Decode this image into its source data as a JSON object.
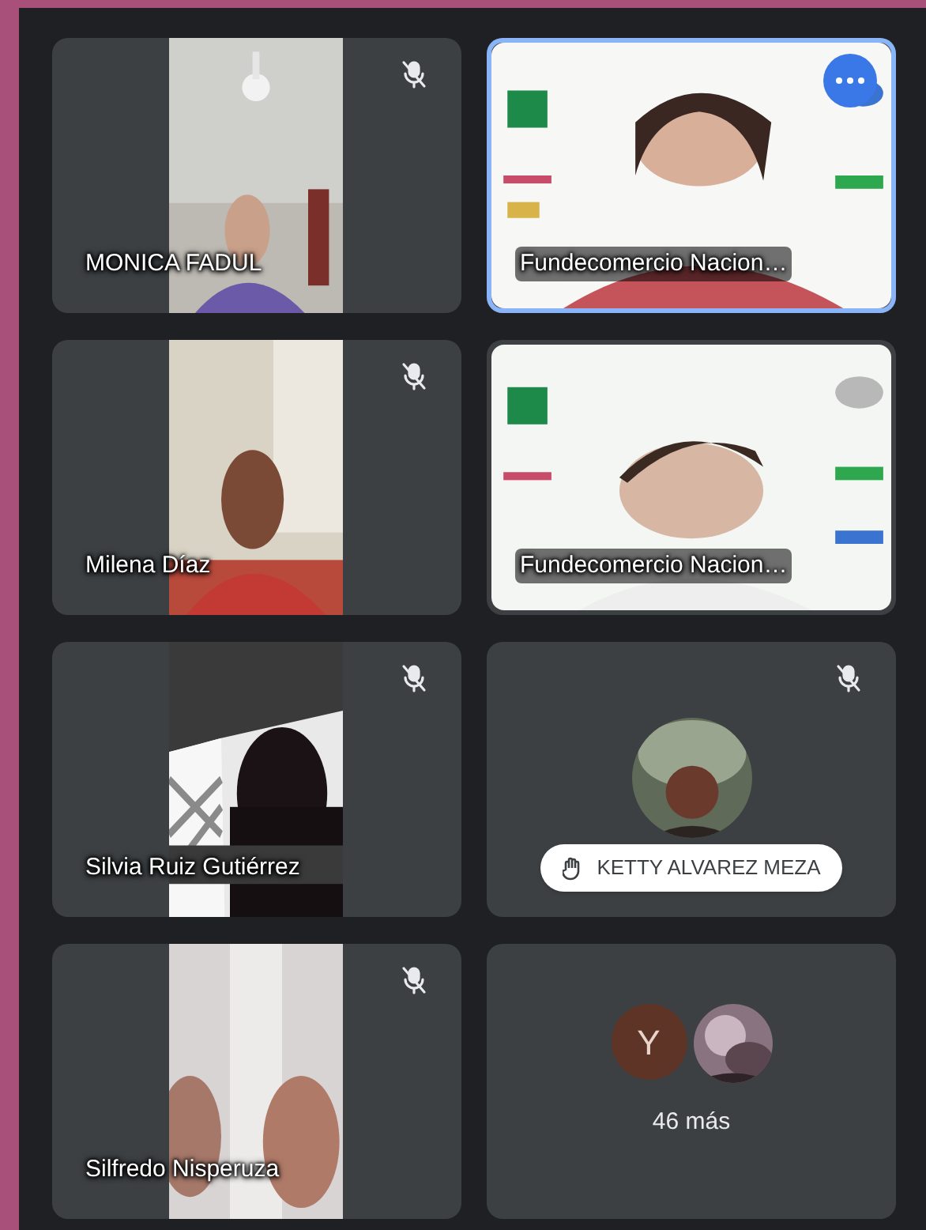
{
  "tiles": [
    {
      "kind": "video",
      "name": "MONICA FADUL",
      "muted": true
    },
    {
      "kind": "video",
      "name": "Fundecomercio Nacion…",
      "speaking": true,
      "more_button": true
    },
    {
      "kind": "video",
      "name": "Milena Díaz",
      "muted": true
    },
    {
      "kind": "video",
      "name": "Fundecomercio Nacion…"
    },
    {
      "kind": "video",
      "name": "Silvia Ruiz Gutiérrez",
      "muted": true
    },
    {
      "name": "KETTY ALVAREZ MEZA",
      "muted": true,
      "hand_raised": true
    },
    {
      "kind": "video",
      "name": "Silfredo Nisperuza",
      "muted": true
    },
    {
      "kind": "overflow",
      "avatars": [
        {
          "kind": "letter",
          "text": "Y",
          "color": "#5e3426"
        },
        {
          "kind": "picture"
        }
      ],
      "label": "46 más"
    }
  ]
}
